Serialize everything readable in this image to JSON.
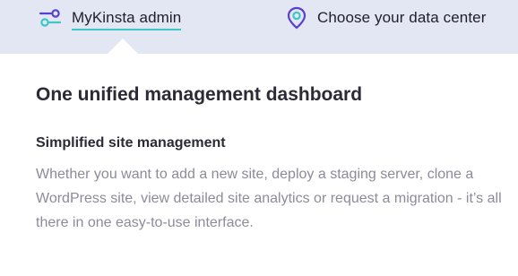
{
  "nav": {
    "tabs": [
      {
        "label": "MyKinsta admin",
        "icon": "sliders-icon",
        "active": true
      },
      {
        "label": "Choose your data center",
        "icon": "map-pin-icon",
        "active": false
      }
    ]
  },
  "panel": {
    "title": "One unified management dashboard",
    "subtitle": "Simplified site management",
    "description": "Whether you want to add a new site, deploy a staging server, clone a WordPress site, view detailed site analytics or request a migration - it’s all there in one easy-to-use interface."
  },
  "colors": {
    "background": "#e2e7f3",
    "accent_teal": "#3ec7c6",
    "accent_purple": "#5b3fd0",
    "title_text": "#2b2a35",
    "body_text": "#8c8b99"
  }
}
